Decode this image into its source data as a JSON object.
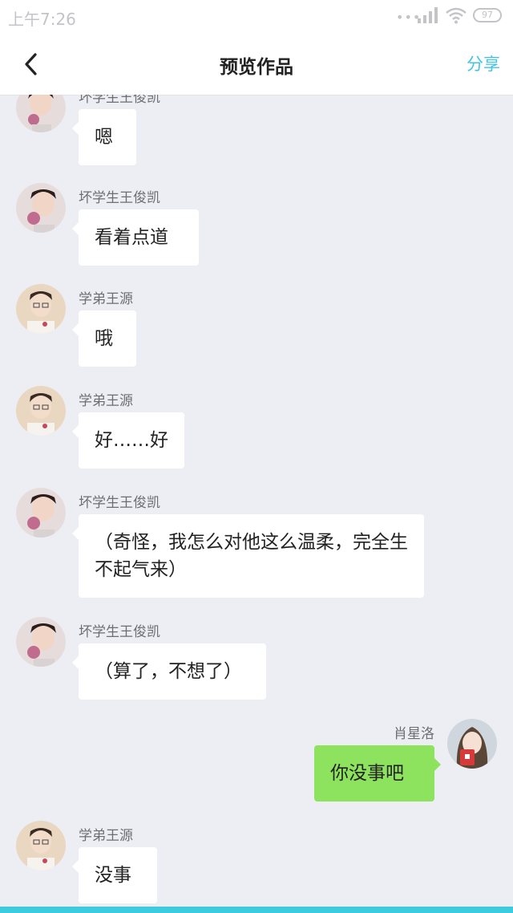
{
  "status_bar": {
    "time": "上午7:26",
    "battery": "97"
  },
  "nav": {
    "title": "预览作品",
    "share_label": "分享",
    "back_icon": "chevron-left-icon"
  },
  "colors": {
    "accent": "#41c4e7",
    "outgoing_bubble": "#8de35e",
    "incoming_bubble": "#ffffff",
    "background": "#eceef3"
  },
  "messages": [
    {
      "sender": "坏学生王俊凯",
      "text": "嗯",
      "side": "left"
    },
    {
      "sender": "坏学生王俊凯",
      "text": "看着点道",
      "side": "left"
    },
    {
      "sender": "学弟王源",
      "text": "哦",
      "side": "left"
    },
    {
      "sender": "学弟王源",
      "text": "好……好",
      "side": "left"
    },
    {
      "sender": "坏学生王俊凯",
      "text": "（奇怪，我怎么对他这么温柔，完全生不起气来）",
      "side": "left"
    },
    {
      "sender": "坏学生王俊凯",
      "text": "（算了，不想了）",
      "side": "left"
    },
    {
      "sender": "肖星洛",
      "text": "你没事吧",
      "side": "right"
    },
    {
      "sender": "学弟王源",
      "text": "没事",
      "side": "left"
    }
  ]
}
